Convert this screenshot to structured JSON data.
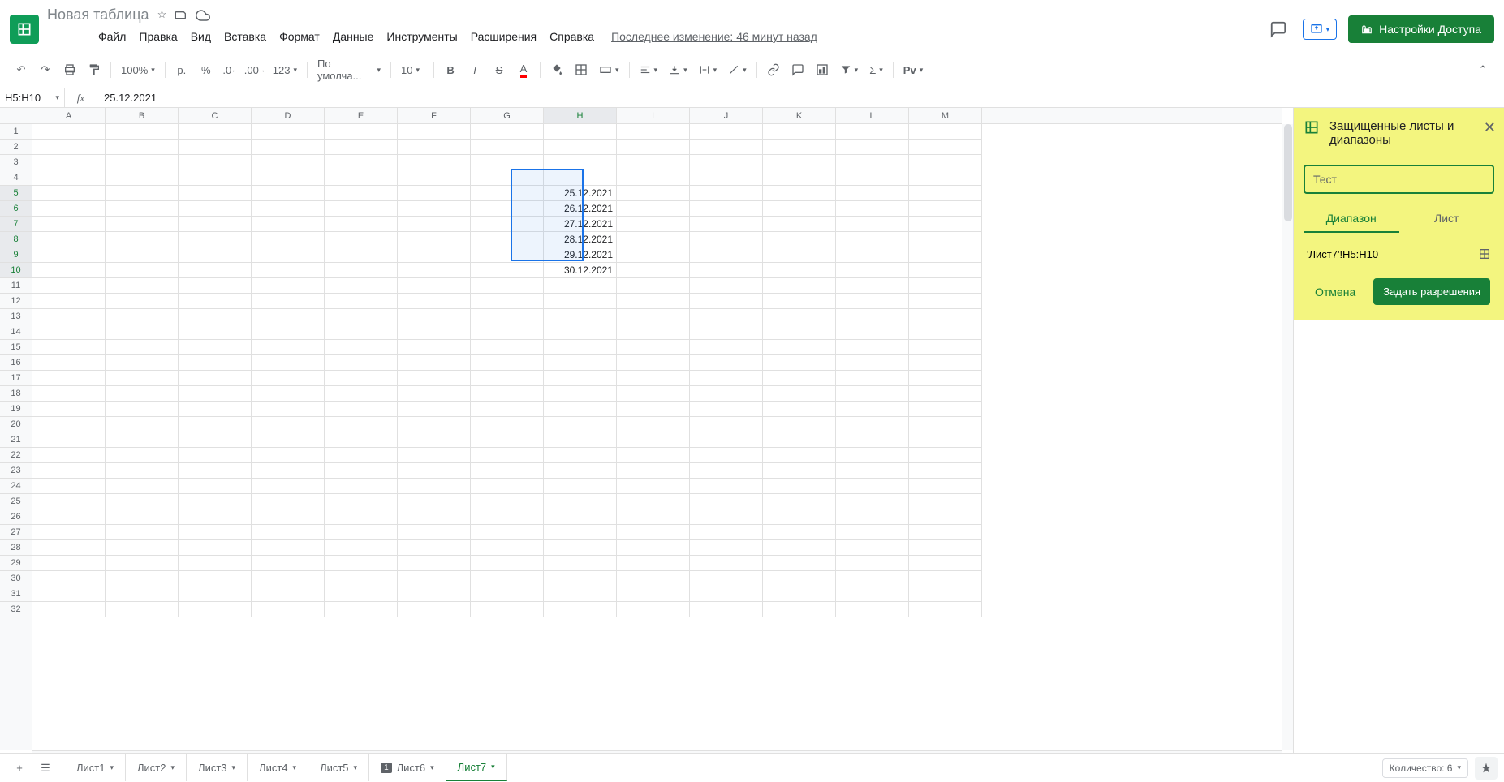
{
  "doc_title": "Новая таблица",
  "menus": [
    "Файл",
    "Правка",
    "Вид",
    "Вставка",
    "Формат",
    "Данные",
    "Инструменты",
    "Расширения",
    "Справка"
  ],
  "last_edit": "Последнее изменение: 46 минут назад",
  "share_label": "Настройки Доступа",
  "toolbar": {
    "zoom": "100%",
    "currency": "р.",
    "font": "По умолча...",
    "font_size": "10",
    "more_format": "123",
    "pv": "Рv"
  },
  "name_box": "H5:H10",
  "formula_value": "25.12.2021",
  "columns": [
    "A",
    "B",
    "C",
    "D",
    "E",
    "F",
    "G",
    "H",
    "I",
    "J",
    "K",
    "L",
    "M"
  ],
  "row_count": 32,
  "selected_col_index": 7,
  "selected_rows": [
    5,
    6,
    7,
    8,
    9,
    10
  ],
  "cell_data": {
    "H5": "25.12.2021",
    "H6": "26.12.2021",
    "H7": "27.12.2021",
    "H8": "28.12.2021",
    "H9": "29.12.2021",
    "H10": "30.12.2021"
  },
  "panel": {
    "title": "Защищенные листы и диапазоны",
    "desc_placeholder": "Тест",
    "tab_range": "Диапазон",
    "tab_sheet": "Лист",
    "range_value": "'Лист7'!H5:H10",
    "cancel": "Отмена",
    "submit": "Задать разрешения"
  },
  "sheet_tabs": [
    "Лист1",
    "Лист2",
    "Лист3",
    "Лист4",
    "Лист5",
    "Лист6",
    "Лист7"
  ],
  "active_sheet_index": 6,
  "badged_sheet_index": 5,
  "badge_text": "1",
  "count_label": "Количество: 6"
}
